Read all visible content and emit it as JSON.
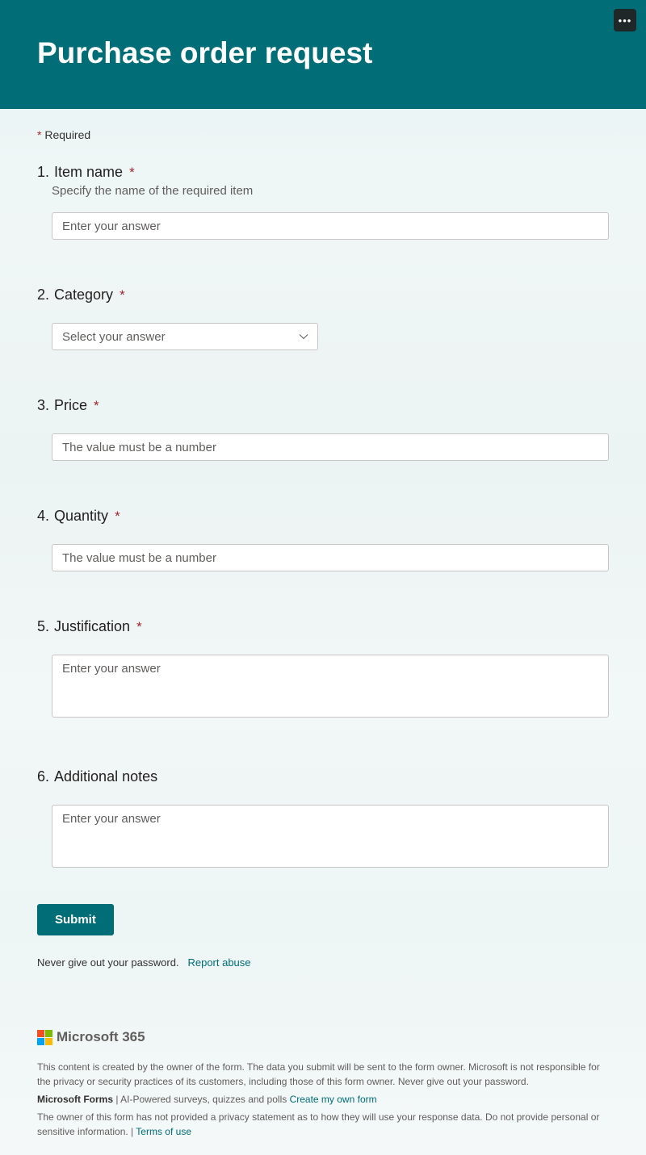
{
  "header": {
    "title": "Purchase order request"
  },
  "required_label": "Required",
  "questions": [
    {
      "number": "1.",
      "label": "Item name",
      "required": true,
      "desc": "Specify the name of the required item",
      "placeholder": "Enter your answer"
    },
    {
      "number": "2.",
      "label": "Category",
      "required": true,
      "placeholder": "Select your answer"
    },
    {
      "number": "3.",
      "label": "Price",
      "required": true,
      "placeholder": "The value must be a number"
    },
    {
      "number": "4.",
      "label": "Quantity",
      "required": true,
      "placeholder": "The value must be a number"
    },
    {
      "number": "5.",
      "label": "Justification",
      "required": true,
      "placeholder": "Enter your answer"
    },
    {
      "number": "6.",
      "label": "Additional notes",
      "required": false,
      "placeholder": "Enter your answer"
    }
  ],
  "submit_label": "Submit",
  "warning": "Never give out your password.",
  "report_abuse": "Report abuse",
  "footer": {
    "logo_text": "Microsoft 365",
    "disclaimer": "This content is created by the owner of the form. The data you submit will be sent to the form owner. Microsoft is not responsible for the privacy or security practices of its customers, including those of this form owner. Never give out your password.",
    "forms_label": "Microsoft Forms",
    "forms_desc": " | AI-Powered surveys, quizzes and polls ",
    "create_link": "Create my own form",
    "privacy_text": "The owner of this form has not provided a privacy statement as to how they will use your response data. Do not provide personal or sensitive information. | ",
    "terms_link": "Terms of use"
  }
}
